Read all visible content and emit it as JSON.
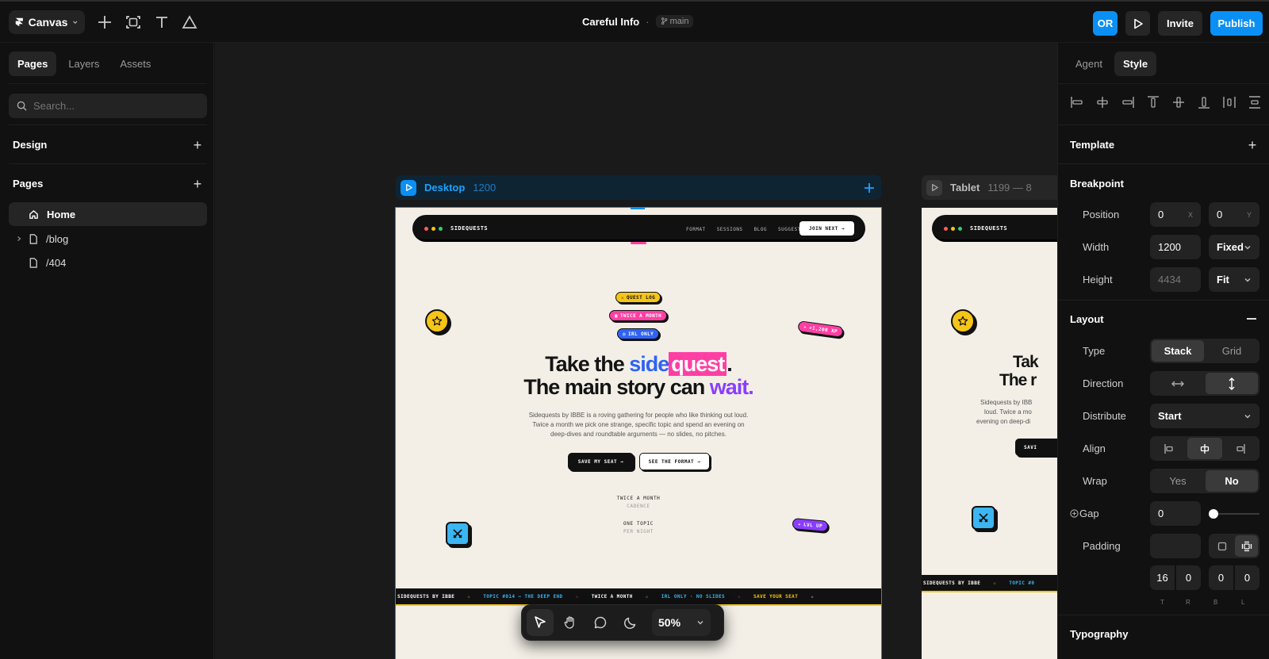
{
  "topbar": {
    "menu_label": "Canvas",
    "project_title": "Careful Info",
    "separator": "·",
    "branch": "main",
    "avatar_initials": "OR",
    "invite_label": "Invite",
    "publish_label": "Publish"
  },
  "left_panel": {
    "tabs": [
      "Pages",
      "Layers",
      "Assets"
    ],
    "search_placeholder": "Search...",
    "design_heading": "Design",
    "pages_heading": "Pages",
    "pages": [
      "Home",
      "/blog",
      "/404"
    ]
  },
  "canvas": {
    "desktop_frame": {
      "name": "Desktop",
      "width_label": "1200"
    },
    "tablet_frame": {
      "name": "Tablet",
      "width_label": "1199 — 8"
    },
    "site": {
      "brand": "SIDEQUESTS",
      "nav": [
        "FORMAT",
        "SESSIONS",
        "BLOG",
        "SUGGEST"
      ],
      "join": "JOIN NEXT →",
      "chips": [
        "QUEST LOG",
        "TWICE A MONTH",
        "IRL ONLY"
      ],
      "xp_chip": "+1,200 XP",
      "lvl_chip": "LVL UP",
      "headline": {
        "pre": "Take the ",
        "side": "side",
        "quest": "quest",
        "dot": ".",
        "line2_pre": "The main story can ",
        "wait": "wait."
      },
      "tablet_headline": {
        "l1": "Tak",
        "l2": "The r"
      },
      "paragraph": "Sidequests by IBBE is a roving gathering for people who like thinking out loud. Twice a month we pick one strange, specific topic and spend an evening on deep-dives and roundtable arguments — no slides, no pitches.",
      "tablet_paragraph": [
        "Sidequests by IBB",
        "loud. Twice a mo",
        "evening on deep-di"
      ],
      "cta_primary": "SAVE MY SEAT →",
      "cta_secondary": "SEE THE FORMAT →",
      "tablet_cta": "SAVI",
      "stats": [
        {
          "value": "TWICE A MONTH",
          "label": "CADENCE"
        },
        {
          "value": "ONE TOPIC",
          "label": "PER NIGHT"
        }
      ],
      "ticker": [
        "SIDEQUESTS BY IBBE",
        "TOPIC #014 — THE DEEP END",
        "TWICE A MONTH",
        "IRL ONLY · NO SLIDES",
        "SAVE YOUR SEAT"
      ],
      "tablet_ticker": [
        "SIDEQUESTS BY IBBE",
        "TOPIC #0"
      ]
    },
    "toolbar": {
      "zoom": "50%"
    }
  },
  "right_panel": {
    "tabs": [
      "Agent",
      "Style"
    ],
    "template_heading": "Template",
    "breakpoint_heading": "Breakpoint",
    "position": {
      "label": "Position",
      "x": "0",
      "x_sub": "X",
      "y": "0",
      "y_sub": "Y"
    },
    "width": {
      "label": "Width",
      "value": "1200",
      "mode": "Fixed"
    },
    "height": {
      "label": "Height",
      "value": "4434",
      "mode": "Fit"
    },
    "layout_heading": "Layout",
    "type": {
      "label": "Type",
      "options": [
        "Stack",
        "Grid"
      ],
      "selected": "Stack"
    },
    "direction": {
      "label": "Direction"
    },
    "distribute": {
      "label": "Distribute",
      "value": "Start"
    },
    "align": {
      "label": "Align"
    },
    "wrap": {
      "label": "Wrap",
      "options": [
        "Yes",
        "No"
      ],
      "selected": "No"
    },
    "gap": {
      "label": "Gap",
      "value": "0"
    },
    "padding": {
      "label": "Padding",
      "values": [
        "16",
        "0",
        "0",
        "0"
      ],
      "sides": [
        "T",
        "R",
        "B",
        "L"
      ]
    },
    "typography_heading": "Typography"
  },
  "colors": {
    "accent_blue": "#0a8ff5",
    "quest_pink": "#ff3fa4",
    "side_blue": "#2e63f5",
    "wait_purple": "#8b3dff",
    "sticker_yellow": "#f5c518",
    "sticker_cyan": "#3cb5f0"
  }
}
